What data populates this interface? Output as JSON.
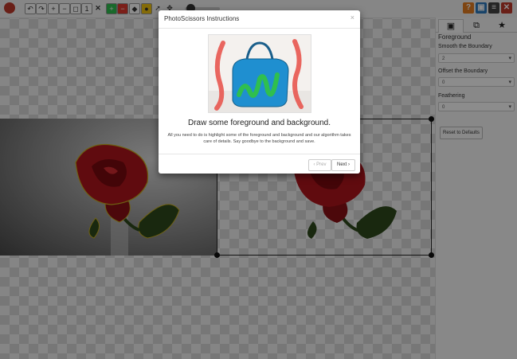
{
  "toolbar": {
    "icons": [
      "logo-icon",
      "undo-icon",
      "redo-icon",
      "zoom-in-icon",
      "zoom-out-icon",
      "zoom-fit-icon",
      "zoom-actual-icon",
      "clear-icon",
      "foreground-marker-icon",
      "background-marker-icon",
      "eraser-icon",
      "hair-brush-icon",
      "cursor-icon",
      "pan-icon",
      "brush-size-icon"
    ],
    "right_buttons": [
      {
        "name": "help-button",
        "glyph": "?",
        "color": "#e67e22"
      },
      {
        "name": "save-button",
        "glyph": "▣",
        "color": "#2c7bc0"
      },
      {
        "name": "menu-button",
        "glyph": "≡",
        "color": "#444444"
      },
      {
        "name": "close-button",
        "glyph": "✕",
        "color": "#c0392b"
      }
    ]
  },
  "sidebar": {
    "tabs": [
      "▣",
      "⧉",
      "★"
    ],
    "section_title": "Foreground",
    "fields": [
      {
        "label": "Smooth the Boundary",
        "value": "2"
      },
      {
        "label": "Offset the Boundary",
        "value": "0"
      },
      {
        "label": "Feathering",
        "value": "0"
      }
    ],
    "reset_label": "Reset to Defaults"
  },
  "modal": {
    "title": "PhotoScissors Instructions",
    "close": "×",
    "heading": "Draw some foreground and background.",
    "body": "All you need to do is highlight some of the foreground and background and our algorithm takes care of details. Say goodbye to the background and save.",
    "prev_label": "‹ Prev",
    "next_label": "Next ›"
  },
  "colors": {
    "rose": "#b0141c",
    "leaf": "#2f4a1c",
    "bag": "#1f8fd0",
    "fg_marker": "#2fbf4f",
    "bg_marker": "#e8574f"
  }
}
